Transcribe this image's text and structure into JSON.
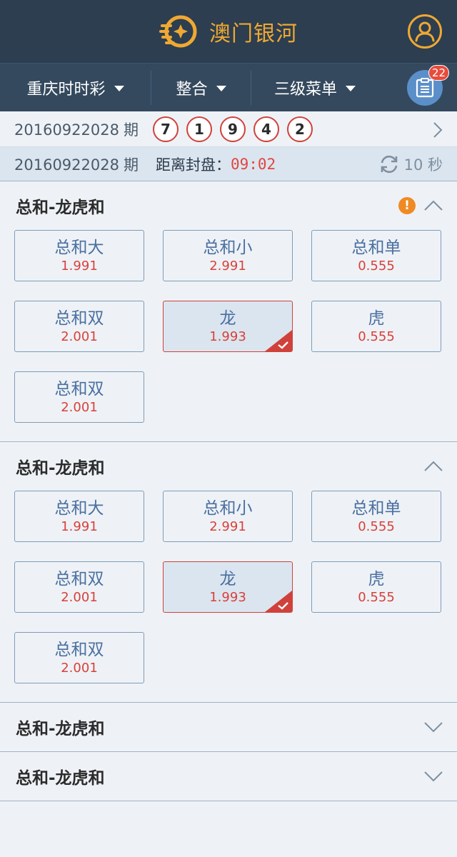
{
  "header": {
    "title": "澳门银河",
    "logo_icon": "coin-logo-icon",
    "user_icon": "user-icon"
  },
  "nav": {
    "items": [
      {
        "label": "重庆时时彩"
      },
      {
        "label": "整合"
      },
      {
        "label": "三级菜单"
      }
    ],
    "clipboard_badge": "22"
  },
  "result": {
    "period": "20160922028",
    "period_suffix": "期",
    "balls": [
      "7",
      "1",
      "9",
      "4",
      "2"
    ]
  },
  "countdown": {
    "period": "20160922028",
    "period_suffix": "期",
    "label": "距离封盘：",
    "time": "09:02",
    "refresh_text": "10 秒"
  },
  "sections": [
    {
      "title": "总和-龙虎和",
      "expanded": true,
      "warning": true,
      "options": [
        {
          "name": "总和大",
          "odds": "1.991",
          "selected": false
        },
        {
          "name": "总和小",
          "odds": "2.991",
          "selected": false
        },
        {
          "name": "总和单",
          "odds": "0.555",
          "selected": false
        },
        {
          "name": "总和双",
          "odds": "2.001",
          "selected": false
        },
        {
          "name": "龙",
          "odds": "1.993",
          "selected": true
        },
        {
          "name": "虎",
          "odds": "0.555",
          "selected": false
        },
        {
          "name": "总和双",
          "odds": "2.001",
          "selected": false
        }
      ]
    },
    {
      "title": "总和-龙虎和",
      "expanded": true,
      "warning": false,
      "options": [
        {
          "name": "总和大",
          "odds": "1.991",
          "selected": false
        },
        {
          "name": "总和小",
          "odds": "2.991",
          "selected": false
        },
        {
          "name": "总和单",
          "odds": "0.555",
          "selected": false
        },
        {
          "name": "总和双",
          "odds": "2.001",
          "selected": false
        },
        {
          "name": "龙",
          "odds": "1.993",
          "selected": true
        },
        {
          "name": "虎",
          "odds": "0.555",
          "selected": false
        },
        {
          "name": "总和双",
          "odds": "2.001",
          "selected": false
        }
      ]
    },
    {
      "title": "总和-龙虎和",
      "expanded": false
    },
    {
      "title": "总和-龙虎和",
      "expanded": false
    }
  ],
  "colors": {
    "header_bg": "#2c3e50",
    "nav_bg": "#34495e",
    "accent_gold": "#f0a832",
    "odds_red": "#d9403a",
    "label_blue": "#4a6fa0"
  }
}
